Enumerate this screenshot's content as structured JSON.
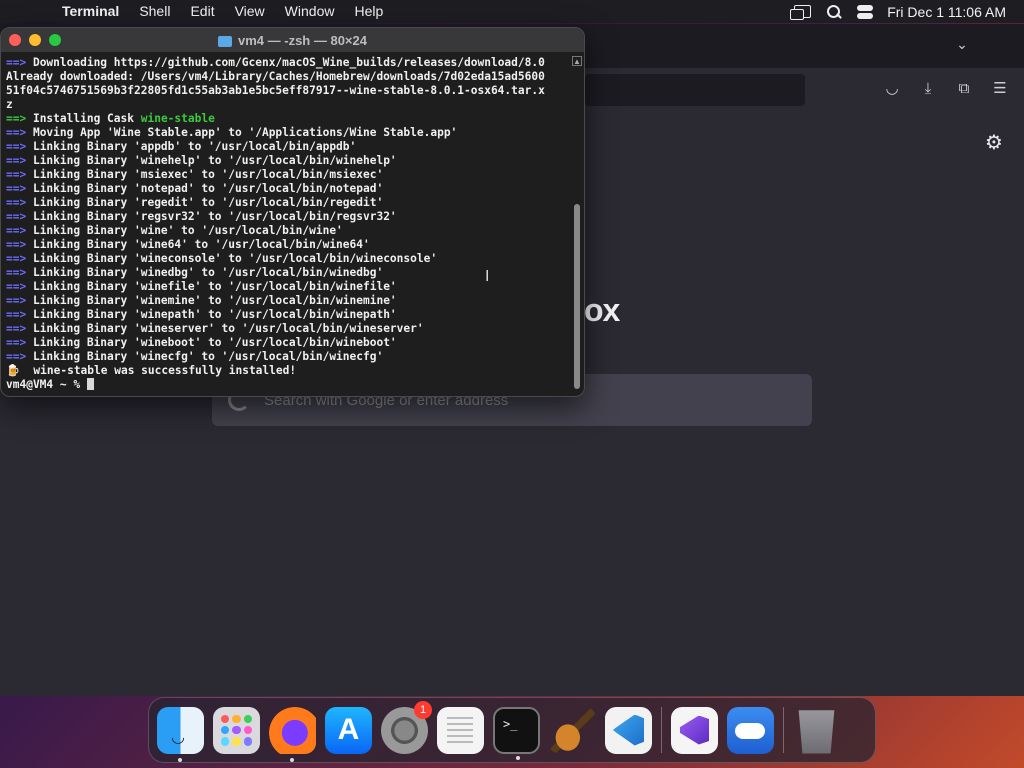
{
  "menubar": {
    "app_name": "Terminal",
    "items": [
      "Shell",
      "Edit",
      "View",
      "Window",
      "Help"
    ],
    "clock": "Fri Dec 1  11:06 AM"
  },
  "browser": {
    "logo_fragment": "ox",
    "search_placeholder": "Search with Google or enter address"
  },
  "terminal": {
    "title": "vm4 — -zsh — 80×24",
    "lines": [
      {
        "prefix": "==>",
        "prefix_color": "blue",
        "text": " Downloading https://github.com/Gcenx/macOS_Wine_builds/releases/download/8.0"
      },
      {
        "prefix": "",
        "text": "Already downloaded: /Users/vm4/Library/Caches/Homebrew/downloads/7d02eda15ad5600"
      },
      {
        "prefix": "",
        "text": "51f04c5746751569b3f22805fd1c55ab3ab1e5bc5eff87917--wine-stable-8.0.1-osx64.tar.x"
      },
      {
        "prefix": "",
        "text": "z"
      },
      {
        "prefix": "==>",
        "prefix_color": "green",
        "text": " Installing Cask ",
        "highlight": "wine-stable"
      },
      {
        "prefix": "==>",
        "prefix_color": "blue",
        "text": " Moving App 'Wine Stable.app' to '/Applications/Wine Stable.app'"
      },
      {
        "prefix": "==>",
        "prefix_color": "blue",
        "text": " Linking Binary 'appdb' to '/usr/local/bin/appdb'"
      },
      {
        "prefix": "==>",
        "prefix_color": "blue",
        "text": " Linking Binary 'winehelp' to '/usr/local/bin/winehelp'"
      },
      {
        "prefix": "==>",
        "prefix_color": "blue",
        "text": " Linking Binary 'msiexec' to '/usr/local/bin/msiexec'"
      },
      {
        "prefix": "==>",
        "prefix_color": "blue",
        "text": " Linking Binary 'notepad' to '/usr/local/bin/notepad'"
      },
      {
        "prefix": "==>",
        "prefix_color": "blue",
        "text": " Linking Binary 'regedit' to '/usr/local/bin/regedit'"
      },
      {
        "prefix": "==>",
        "prefix_color": "blue",
        "text": " Linking Binary 'regsvr32' to '/usr/local/bin/regsvr32'"
      },
      {
        "prefix": "==>",
        "prefix_color": "blue",
        "text": " Linking Binary 'wine' to '/usr/local/bin/wine'"
      },
      {
        "prefix": "==>",
        "prefix_color": "blue",
        "text": " Linking Binary 'wine64' to '/usr/local/bin/wine64'"
      },
      {
        "prefix": "==>",
        "prefix_color": "blue",
        "text": " Linking Binary 'wineconsole' to '/usr/local/bin/wineconsole'"
      },
      {
        "prefix": "==>",
        "prefix_color": "blue",
        "text": " Linking Binary 'winedbg' to '/usr/local/bin/winedbg'"
      },
      {
        "prefix": "==>",
        "prefix_color": "blue",
        "text": " Linking Binary 'winefile' to '/usr/local/bin/winefile'"
      },
      {
        "prefix": "==>",
        "prefix_color": "blue",
        "text": " Linking Binary 'winemine' to '/usr/local/bin/winemine'"
      },
      {
        "prefix": "==>",
        "prefix_color": "blue",
        "text": " Linking Binary 'winepath' to '/usr/local/bin/winepath'"
      },
      {
        "prefix": "==>",
        "prefix_color": "blue",
        "text": " Linking Binary 'wineserver' to '/usr/local/bin/wineserver'"
      },
      {
        "prefix": "==>",
        "prefix_color": "blue",
        "text": " Linking Binary 'wineboot' to '/usr/local/bin/wineboot'"
      },
      {
        "prefix": "==>",
        "prefix_color": "blue",
        "text": " Linking Binary 'winecfg' to '/usr/local/bin/winecfg'"
      },
      {
        "prefix": "🍺",
        "prefix_color": "none",
        "text": "  wine-stable was successfully installed!"
      }
    ],
    "prompt": "vm4@VM4 ~ % "
  },
  "dock": {
    "items": [
      {
        "name": "finder",
        "running": true
      },
      {
        "name": "launchpad",
        "running": false
      },
      {
        "name": "firefox",
        "running": true
      },
      {
        "name": "app-store",
        "running": false
      },
      {
        "name": "system-settings",
        "running": false,
        "badge": "1"
      },
      {
        "name": "textedit",
        "running": false
      },
      {
        "name": "terminal",
        "running": true
      },
      {
        "name": "garageband",
        "running": false
      },
      {
        "name": "vscode",
        "running": false
      },
      {
        "name": "visual-studio",
        "running": false
      },
      {
        "name": "weather",
        "running": false
      },
      {
        "name": "trash",
        "running": false
      }
    ]
  },
  "colors": {
    "prefix_blue": "#6b6bff",
    "prefix_green": "#3cc93c",
    "terminal_bg": "#1e1e1e",
    "browser_bg": "#2b2a33"
  }
}
